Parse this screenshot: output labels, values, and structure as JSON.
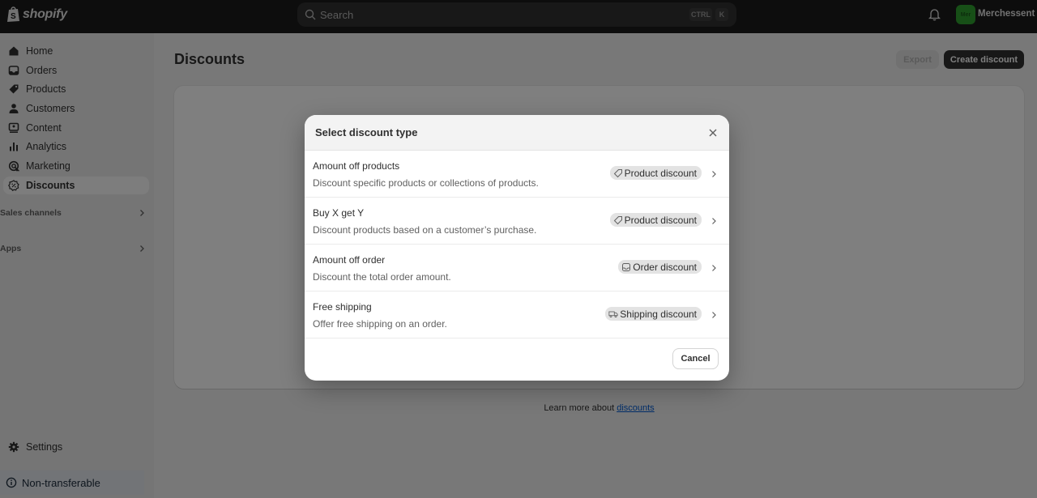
{
  "topbar": {
    "logo_text": "shopify",
    "search_placeholder": "Search",
    "shortcut_key1": "CTRL",
    "shortcut_key2": "K",
    "avatar_initials": "Mer",
    "store_name": "Merchessent",
    "avatar_color": "#2f9e2f"
  },
  "sidebar": {
    "items": [
      {
        "label": "Home",
        "icon": "home-icon"
      },
      {
        "label": "Orders",
        "icon": "inbox-icon"
      },
      {
        "label": "Products",
        "icon": "tag-icon"
      },
      {
        "label": "Customers",
        "icon": "person-icon"
      },
      {
        "label": "Content",
        "icon": "image-icon"
      },
      {
        "label": "Analytics",
        "icon": "bar-chart-icon"
      },
      {
        "label": "Marketing",
        "icon": "target-icon"
      },
      {
        "label": "Discounts",
        "icon": "discount-icon",
        "active": true
      }
    ],
    "sections": [
      {
        "label": "Sales channels"
      },
      {
        "label": "Apps"
      }
    ],
    "settings_label": "Settings",
    "nontransferable_label": "Non-transferable"
  },
  "main": {
    "title": "Discounts",
    "export_label": "Export",
    "create_label": "Create discount",
    "learn_prefix": "Learn more about ",
    "learn_link": "discounts"
  },
  "modal": {
    "title": "Select discount type",
    "options": [
      {
        "title": "Amount off products",
        "description": "Discount specific products or collections of products.",
        "badge": "Product discount",
        "badge_icon": "tag-icon"
      },
      {
        "title": "Buy X get Y",
        "description": "Discount products based on a customer’s purchase.",
        "badge": "Product discount",
        "badge_icon": "tag-icon"
      },
      {
        "title": "Amount off order",
        "description": "Discount the total order amount.",
        "badge": "Order discount",
        "badge_icon": "order-icon"
      },
      {
        "title": "Free shipping",
        "description": "Offer free shipping on an order.",
        "badge": "Shipping discount",
        "badge_icon": "truck-icon"
      }
    ],
    "cancel_label": "Cancel"
  }
}
